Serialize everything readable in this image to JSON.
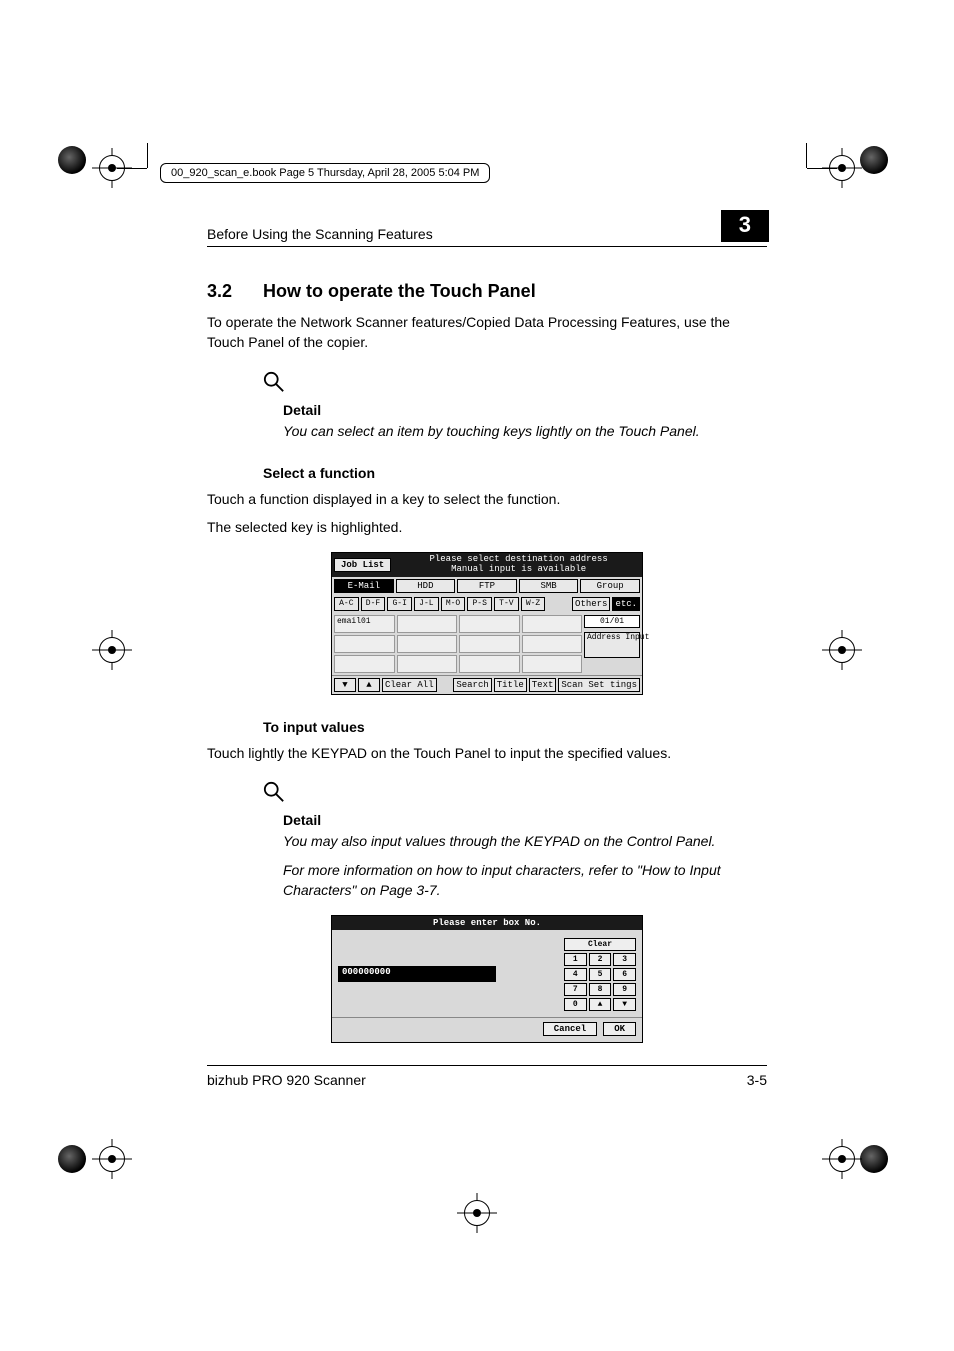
{
  "meta_line": "00_920_scan_e.book  Page 5  Thursday, April 28, 2005  5:04 PM",
  "running_head": "Before Using the Scanning Features",
  "chapter_number": "3",
  "section": {
    "number": "3.2",
    "title": "How to operate the Touch Panel"
  },
  "intro_para": "To operate the Network Scanner features/Copied Data Processing Features, use the Touch Panel of the copier.",
  "detail1": {
    "label": "Detail",
    "text": "You can select an item by touching keys lightly on the Touch Panel."
  },
  "select_function_head": "Select a function",
  "select_function_p1": "Touch a function displayed in a key to select the function.",
  "select_function_p2": "The selected key is highlighted.",
  "ui1": {
    "job_list": "Job List",
    "msg1": "Please select destination address",
    "msg2": "Manual input is available",
    "tabs": [
      "E-Mail",
      "HDD",
      "FTP",
      "SMB",
      "Group"
    ],
    "selected_tab_index": 0,
    "az": [
      "A-C",
      "D-F",
      "G-I",
      "J-L",
      "M-O",
      "P-S",
      "T-V",
      "W-Z"
    ],
    "others": "Others",
    "icon_btn": "etc.",
    "list_item": "email01",
    "counter": "01/01",
    "side_btn": "Address Input",
    "bottom": {
      "up": "▲",
      "down": "▼",
      "clear_all": "Clear All",
      "search": "Search",
      "title": "Title",
      "text": "Text",
      "scan_set": "Scan Set tings"
    }
  },
  "input_values_head": "To input values",
  "input_values_p": "Touch lightly the KEYPAD on the Touch Panel to input the specified values.",
  "detail2": {
    "label": "Detail",
    "text1": "You may also input values through the KEYPAD on the Control Panel.",
    "text2": "For more information on how to input characters, refer to \"How to Input Characters\" on Page 3-7."
  },
  "ui2": {
    "title": "Please enter box No.",
    "display_value": "000000000",
    "clear": "Clear",
    "keys": [
      [
        "1",
        "2",
        "3"
      ],
      [
        "4",
        "5",
        "6"
      ],
      [
        "7",
        "8",
        "9"
      ],
      [
        "0",
        "▲",
        "▼"
      ]
    ],
    "cancel": "Cancel",
    "ok": "OK"
  },
  "footer_left": "bizhub PRO 920 Scanner",
  "footer_right": "3-5"
}
